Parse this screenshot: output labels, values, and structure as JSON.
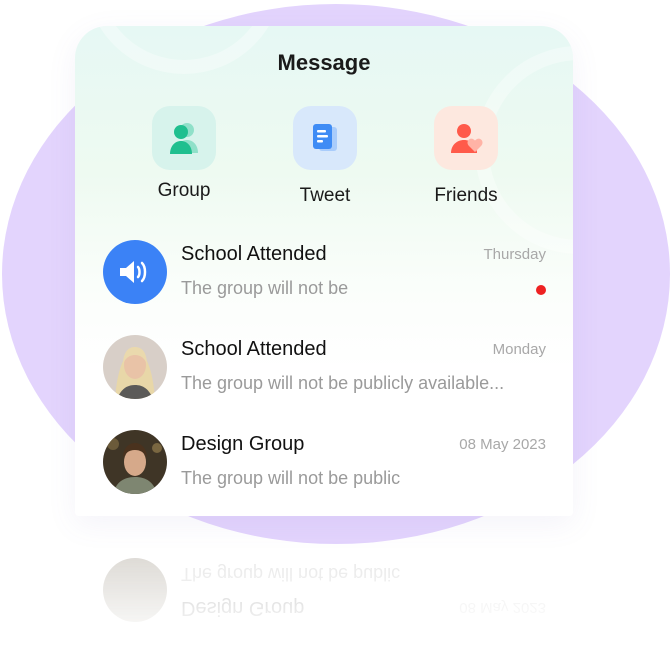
{
  "header": {
    "title": "Message"
  },
  "shortcuts": [
    {
      "label": "Group",
      "icon": "group-icon",
      "color": "#20c997",
      "bg": "#d7f3ec"
    },
    {
      "label": "Tweet",
      "icon": "document-icon",
      "color": "#3f8cf5",
      "bg": "#d8e8fb"
    },
    {
      "label": "Friends",
      "icon": "friend-heart-icon",
      "color": "#ff5a4a",
      "bg": "#fde8df"
    }
  ],
  "messages": [
    {
      "name": "School Attended",
      "preview": "The group will not be",
      "time": "Thursday",
      "unread": true,
      "avatar": "speaker-avatar-icon",
      "avatar_color": "#3b82f6"
    },
    {
      "name": "School Attended",
      "preview": "The group will not be publicly available...",
      "time": "Monday",
      "unread": false,
      "avatar": "user-photo-woman"
    },
    {
      "name": "Design Group",
      "preview": "The group will not be public",
      "time": "08 May 2023",
      "unread": false,
      "avatar": "user-photo-man"
    }
  ]
}
